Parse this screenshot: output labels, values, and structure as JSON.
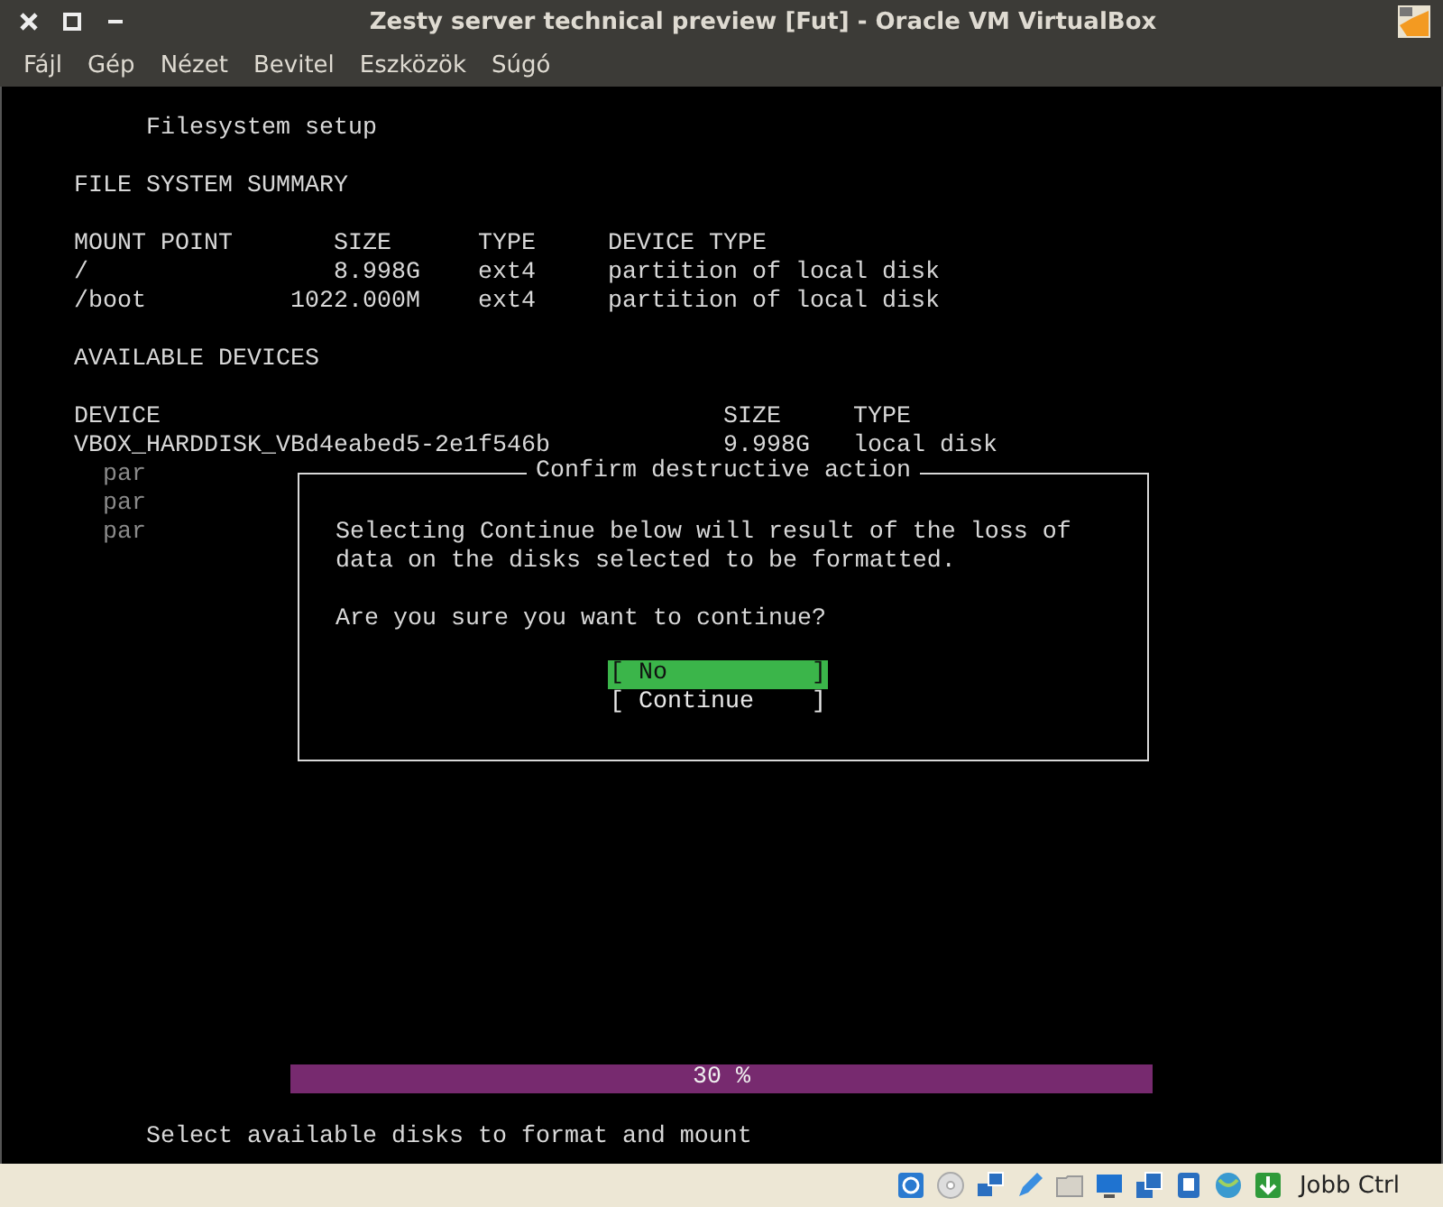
{
  "window": {
    "title": "Zesty server technical preview [Fut] - Oracle VM VirtualBox"
  },
  "menu": [
    "Fájl",
    "Gép",
    "Nézet",
    "Bevitel",
    "Eszközök",
    "Súgó"
  ],
  "screen": {
    "heading": "Filesystem setup",
    "summary": {
      "title": "FILE SYSTEM SUMMARY",
      "columns": [
        "MOUNT POINT",
        "SIZE",
        "TYPE",
        "DEVICE TYPE"
      ],
      "rows": [
        [
          "/",
          "8.998G",
          "ext4",
          "partition of local disk"
        ],
        [
          "/boot",
          "1022.000M",
          "ext4",
          "partition of local disk"
        ]
      ]
    },
    "devices": {
      "title": "AVAILABLE DEVICES",
      "columns": [
        "DEVICE",
        "SIZE",
        "TYPE"
      ],
      "rows": [
        [
          "VBOX_HARDDISK_VBd4eabed5-2e1f546b",
          "9.998G",
          "local disk"
        ]
      ],
      "partitions": [
        "par",
        "par",
        "par"
      ]
    },
    "dialog": {
      "title": "Confirm destructive action",
      "message": "Selecting Continue below will result of the loss of\ndata on the disks selected to be formatted.",
      "question": "Are you sure you want to continue?",
      "buttons": [
        {
          "label": "[ No          ]",
          "selected": true
        },
        {
          "label": "[ Continue    ]",
          "selected": false
        }
      ]
    },
    "progress": {
      "text": "30 %"
    },
    "hint": "Select available disks to format and mount"
  },
  "status_bar": {
    "host_key": "Jobb Ctrl"
  }
}
